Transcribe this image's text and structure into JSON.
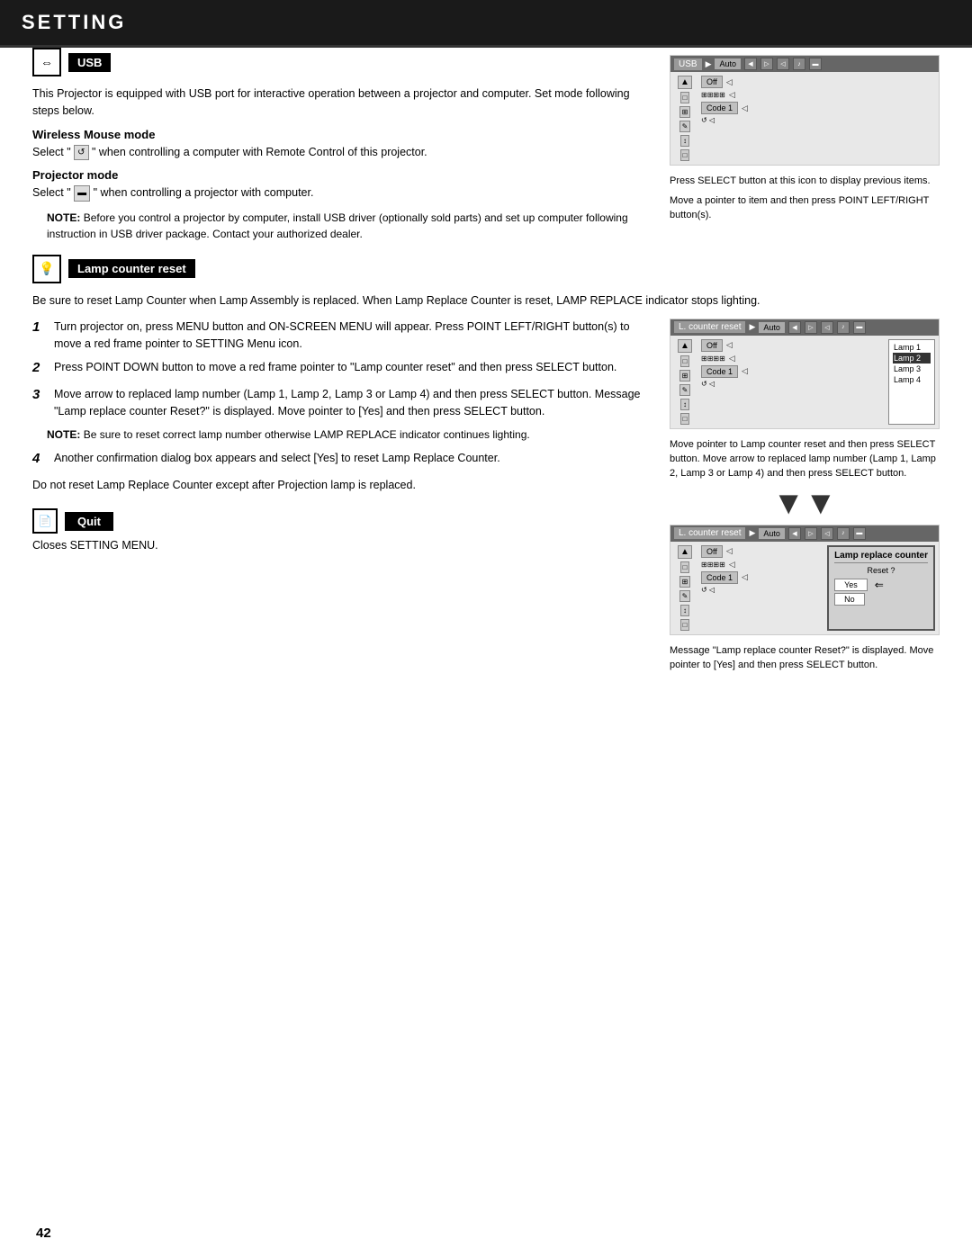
{
  "header": {
    "title": "SETTING",
    "rule_visible": true
  },
  "usb_section": {
    "icon": "↔",
    "label": "USB",
    "body": "This Projector is equipped with USB port for interactive operation between a projector and computer. Set mode following steps below.",
    "wireless_mouse": {
      "heading": "Wireless Mouse mode",
      "text": "Select \"   \" when controlling a computer with Remote Control of this projector."
    },
    "projector_mode": {
      "heading": "Projector mode",
      "text": "Select \"   \" when controlling a projector with computer."
    },
    "note": "Before you control a projector by computer, install USB driver (optionally sold parts) and set up computer following instruction in USB driver package. Contact your authorized dealer.",
    "ui_header_label": "USB",
    "ui_auto": "Auto",
    "ui_caption1": "Press SELECT button at this icon to display previous items.",
    "ui_caption2": "Move a pointer to item and then press POINT LEFT/RIGHT button(s)."
  },
  "lamp_section": {
    "icon": "💡",
    "label": "Lamp counter reset",
    "intro": "Be sure to reset Lamp Counter when Lamp Assembly is replaced.  When Lamp Replace Counter is reset, LAMP REPLACE indicator stops lighting.",
    "steps": [
      {
        "num": "1",
        "text": "Turn projector on, press MENU button and ON-SCREEN MENU will appear.  Press POINT LEFT/RIGHT button(s) to move a red frame pointer to SETTING Menu icon."
      },
      {
        "num": "2",
        "text": "Press POINT DOWN button to move a red frame pointer to \"Lamp counter reset\" and then press SELECT button."
      },
      {
        "num": "3",
        "text": "Move arrow to replaced lamp number (Lamp 1, Lamp 2, Lamp 3 or Lamp 4) and then press SELECT button.  Message \"Lamp replace counter Reset?\" is displayed. Move pointer to [Yes] and then press SELECT button."
      },
      {
        "num": "4",
        "text": "Another confirmation dialog box appears and select [Yes] to reset Lamp Replace Counter."
      }
    ],
    "note3": "Be sure to reset correct lamp number otherwise LAMP REPLACE indicator continues lighting.",
    "closing": "Do not reset Lamp Replace Counter except after Projection lamp is replaced.",
    "ui1_header": "L. counter reset",
    "ui1_auto": "Auto",
    "ui1_caption": "Move pointer to Lamp counter reset and then press SELECT button.  Move arrow to replaced lamp number (Lamp 1, Lamp 2, Lamp 3 or Lamp 4) and then press SELECT button.",
    "lamp_items": [
      "Lamp 1",
      "Lamp 2",
      "Lamp 3",
      "Lamp 4"
    ],
    "ui2_header": "L. counter reset",
    "ui2_auto": "Auto",
    "dialog_title": "Lamp replace counter",
    "dialog_subtitle": "Reset ?",
    "dialog_yes": "Yes",
    "dialog_no": "No",
    "ui2_caption": "Message \"Lamp replace counter Reset?\" is displayed. Move pointer to [Yes] and then press SELECT button."
  },
  "quit_section": {
    "icon": "📄",
    "label": "Quit",
    "text": "Closes SETTING MENU."
  },
  "page_number": "42"
}
